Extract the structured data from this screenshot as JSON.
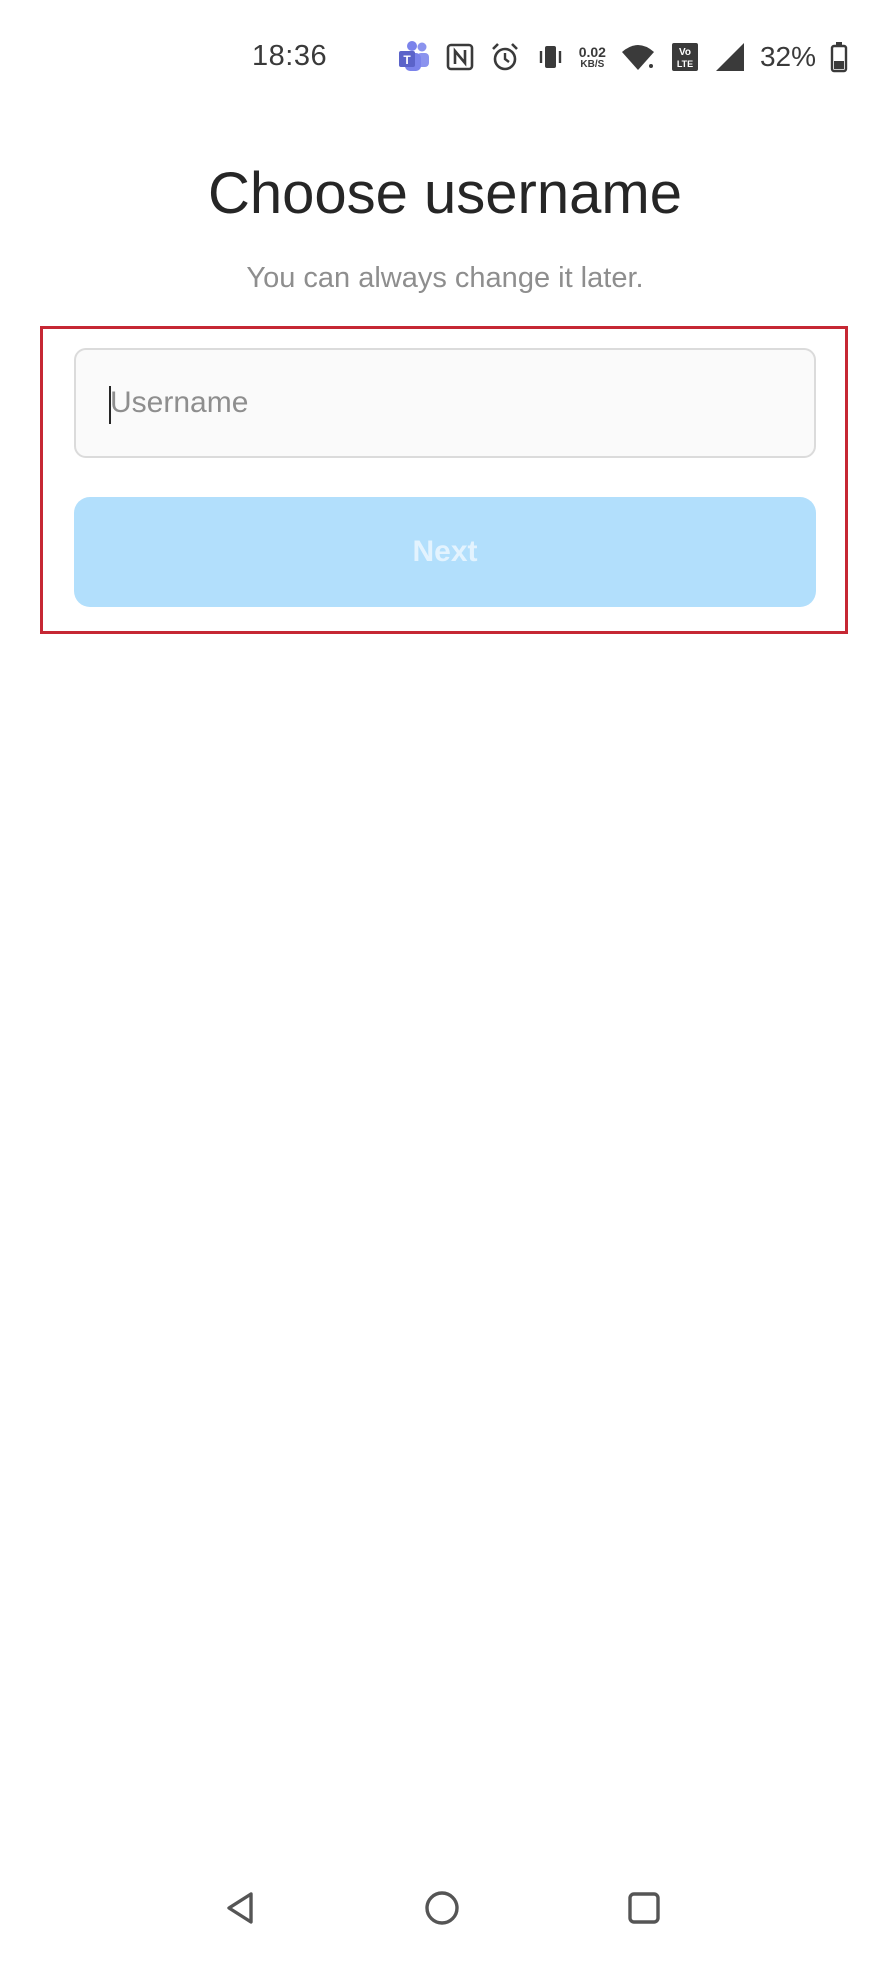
{
  "status_bar": {
    "time": "18:36",
    "network_speed_value": "0.02",
    "network_speed_unit": "KB/S",
    "battery_percent": "32%",
    "icons": [
      "teams-icon",
      "nfc-icon",
      "alarm-icon",
      "vibrate-icon",
      "wifi-icon",
      "volte-icon",
      "signal-icon",
      "battery-icon"
    ]
  },
  "main": {
    "title": "Choose username",
    "subtitle": "You can always change it later.",
    "username_input": {
      "placeholder": "Username",
      "value": ""
    },
    "next_button": {
      "label": "Next",
      "enabled": false
    }
  },
  "colors": {
    "highlight_border": "#c62834",
    "button_disabled_bg": "#b2dffc",
    "button_disabled_text": "#e3f3fe",
    "input_bg": "#fafafa",
    "input_border": "#dbdbdb",
    "teams_purple": "#7b83eb"
  },
  "nav_bar": {
    "icons": [
      "back-icon",
      "home-icon",
      "recents-icon"
    ]
  }
}
